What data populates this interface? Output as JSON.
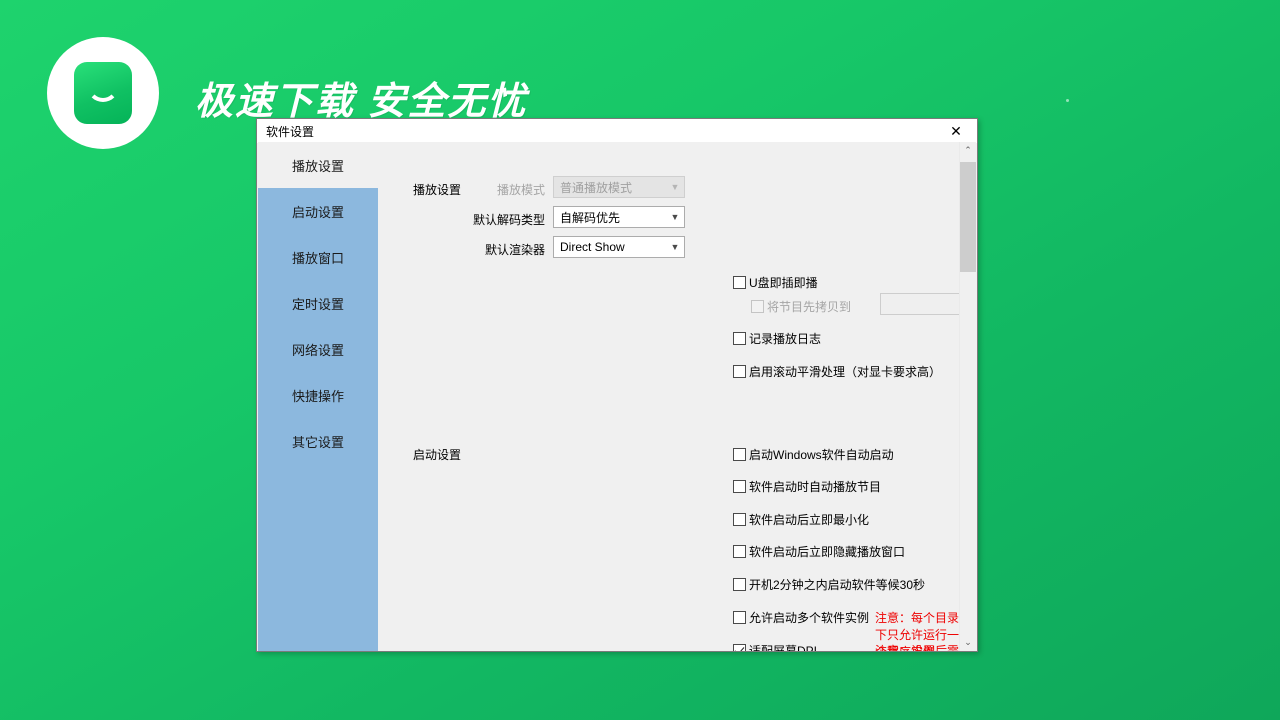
{
  "banner": {
    "slogan": "极速下载  安全无忧",
    "logo_icon": "shopping-bag-icon"
  },
  "dialog": {
    "title": "软件设置",
    "close_label": "✕",
    "close_icon": "close-icon"
  },
  "sidebar": {
    "items": [
      {
        "label": "播放设置",
        "selected": true
      },
      {
        "label": "启动设置",
        "selected": false
      },
      {
        "label": "播放窗口",
        "selected": false
      },
      {
        "label": "定时设置",
        "selected": false
      },
      {
        "label": "网络设置",
        "selected": false
      },
      {
        "label": "快捷操作",
        "selected": false
      },
      {
        "label": "其它设置",
        "selected": false
      }
    ],
    "highlight_color": "#8cb8de"
  },
  "playback_section": {
    "group_label": "播放设置",
    "fields": [
      {
        "label": "播放模式",
        "value": "普通播放模式",
        "disabled": true
      },
      {
        "label": "默认解码类型",
        "value": "自解码优先",
        "disabled": false
      },
      {
        "label": "默认渲染器",
        "value": "Direct Show",
        "disabled": false
      }
    ],
    "checkboxes": [
      {
        "label": "U盘即插即播",
        "checked": false,
        "disabled": false
      },
      {
        "label": "将节目先拷贝到",
        "checked": false,
        "disabled": true
      },
      {
        "label": "记录播放日志",
        "checked": false,
        "disabled": false
      },
      {
        "label": "启用滚动平滑处理（对显卡要求高）",
        "checked": false,
        "disabled": false
      }
    ],
    "copy_path": {
      "value": "",
      "placeholder": "",
      "browse_label": "..."
    }
  },
  "startup_section": {
    "group_label": "启动设置",
    "checkboxes": [
      {
        "label": "启动Windows软件自动启动",
        "checked": false,
        "note": ""
      },
      {
        "label": "软件启动时自动播放节目",
        "checked": false,
        "note": ""
      },
      {
        "label": "软件启动后立即最小化",
        "checked": false,
        "note": ""
      },
      {
        "label": "软件启动后立即隐藏播放窗口",
        "checked": false,
        "note": ""
      },
      {
        "label": "开机2分钟之内启动软件等候30秒",
        "checked": false,
        "note": ""
      },
      {
        "label": "允许启动多个软件实例",
        "checked": false,
        "note": "注意：每个目录下只允许运行一个程序实例"
      },
      {
        "label": "适配屏幕DPI",
        "checked": true,
        "note": "注意：设置后需要重新启动LEDVISION才能生效。"
      }
    ],
    "note_color": "#ee0000"
  },
  "scrollbar": {
    "up_icon": "chevron-up-icon",
    "down_icon": "chevron-down-icon",
    "up_label": "⌃",
    "down_label": "⌄"
  },
  "theme": {
    "background_green_top": "#1ed36d",
    "background_green_bottom": "#0fa75a",
    "dialog_background": "#f0f0f0"
  }
}
